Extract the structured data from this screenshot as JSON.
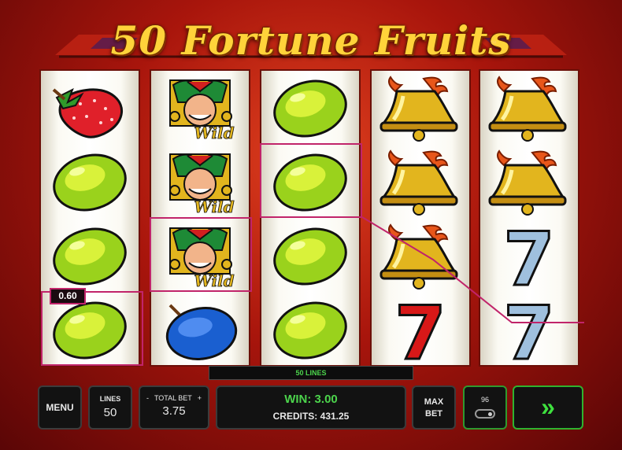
{
  "game": {
    "title": "50 Fortune Fruits",
    "trademark": "™"
  },
  "reels": [
    [
      "strawberry",
      "lime",
      "lime",
      "lime"
    ],
    [
      "joker-wild",
      "joker-wild",
      "joker-wild",
      "plum"
    ],
    [
      "lime",
      "lime",
      "lime",
      "lime"
    ],
    [
      "bell",
      "bell",
      "bell",
      "seven"
    ],
    [
      "bell",
      "bell",
      "seven",
      "seven"
    ]
  ],
  "wild_label": "Wild",
  "seven_label": "7",
  "win_line_value": "0.60",
  "lines_banner": "50 LINES",
  "controls": {
    "menu_label": "MENU",
    "lines_label": "LINES",
    "lines_value": "50",
    "bet_minus": "-",
    "bet_label": "TOTAL BET",
    "bet_plus": "+",
    "bet_value": "3.75",
    "win_text": "WIN: 3.00",
    "credits_text": "CREDITS: 431.25",
    "maxbet_line1": "MAX",
    "maxbet_line2": "BET",
    "autoplay_count": "96",
    "spin_glyph": "»"
  },
  "colors": {
    "win_highlight": "#c1246a",
    "win_green": "#4cd44c",
    "title_gold": "#ffd33a"
  }
}
